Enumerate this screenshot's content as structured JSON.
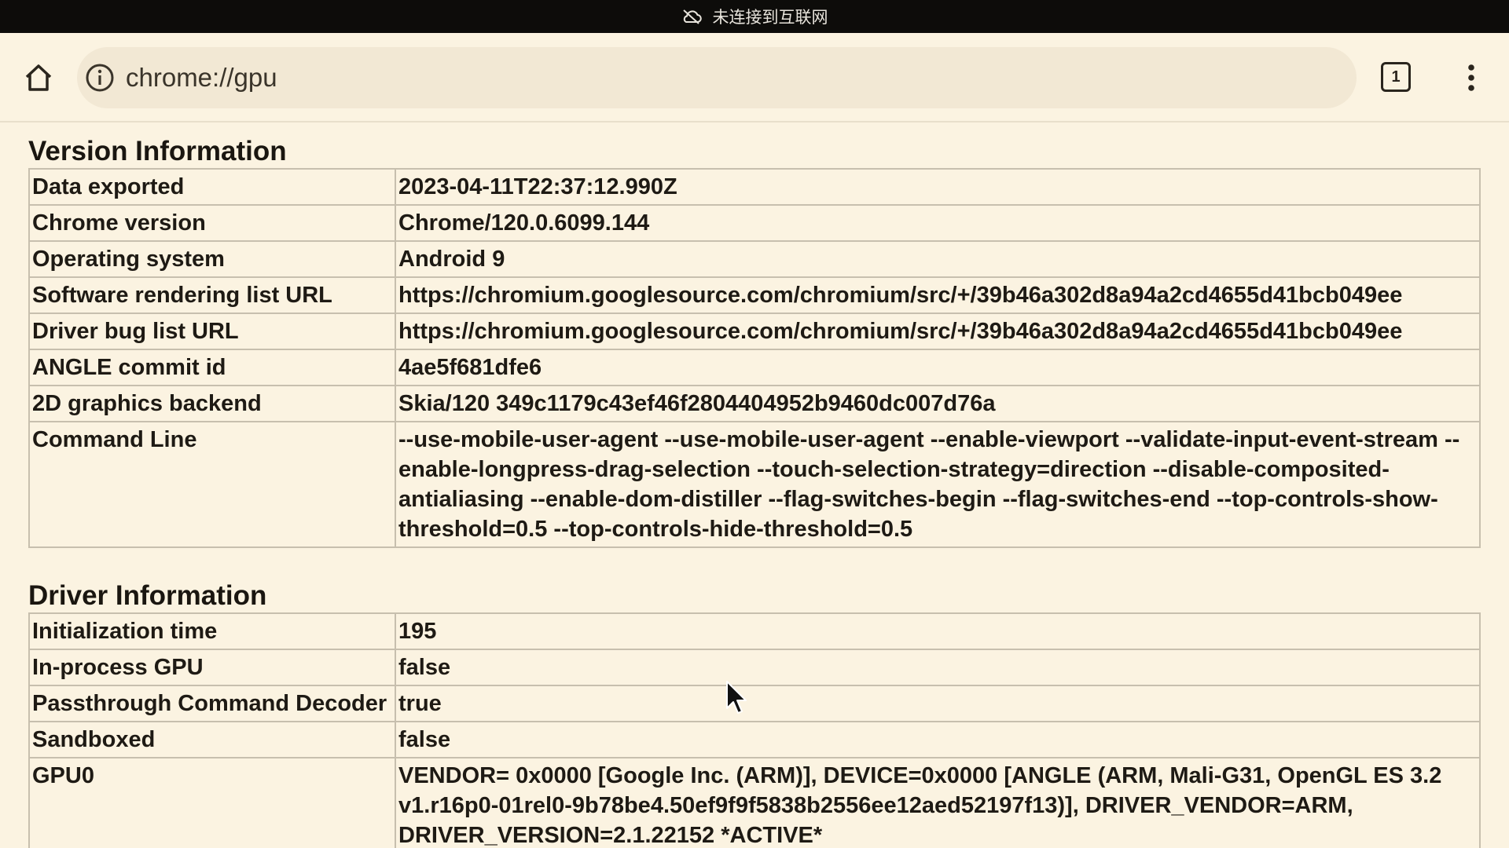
{
  "status_bar": {
    "text": "未连接到互联网",
    "icon": "cloud-off-icon"
  },
  "toolbar": {
    "url": "chrome://gpu",
    "tab_count": "1",
    "home_icon": "home-icon",
    "info_icon": "info-icon",
    "menu_icon": "more-vert-icon"
  },
  "version_info": {
    "title": "Version Information",
    "rows": [
      {
        "key": "Data exported",
        "value": "2023-04-11T22:37:12.990Z"
      },
      {
        "key": "Chrome version",
        "value": "Chrome/120.0.6099.144"
      },
      {
        "key": "Operating system",
        "value": "Android 9"
      },
      {
        "key": "Software rendering list URL",
        "value": "https://chromium.googlesource.com/chromium/src/+/39b46a302d8a94a2cd4655d41bcb049ee"
      },
      {
        "key": "Driver bug list URL",
        "value": "https://chromium.googlesource.com/chromium/src/+/39b46a302d8a94a2cd4655d41bcb049ee"
      },
      {
        "key": "ANGLE commit id",
        "value": "4ae5f681dfe6"
      },
      {
        "key": "2D graphics backend",
        "value": "Skia/120 349c1179c43ef46f2804404952b9460dc007d76a"
      },
      {
        "key": "Command Line",
        "value": "--use-mobile-user-agent --use-mobile-user-agent --enable-viewport --validate-input-event-stream --enable-longpress-drag-selection --touch-selection-strategy=direction --disable-composited-antialiasing --enable-dom-distiller --flag-switches-begin --flag-switches-end --top-controls-show-threshold=0.5 --top-controls-hide-threshold=0.5"
      }
    ]
  },
  "driver_info": {
    "title": "Driver Information",
    "rows": [
      {
        "key": "Initialization time",
        "value": "195"
      },
      {
        "key": "In-process GPU",
        "value": "false"
      },
      {
        "key": "Passthrough Command Decoder",
        "value": "true"
      },
      {
        "key": "Sandboxed",
        "value": "false"
      },
      {
        "key": "GPU0",
        "value": "VENDOR= 0x0000 [Google Inc. (ARM)], DEVICE=0x0000 [ANGLE (ARM, Mali-G31, OpenGL ES 3.2 v1.r16p0-01rel0-9b78be4.50ef9f9f5838b2556ee12aed52197f13)], DRIVER_VENDOR=ARM, DRIVER_VERSION=2.1.22152 *ACTIVE*"
      }
    ]
  }
}
